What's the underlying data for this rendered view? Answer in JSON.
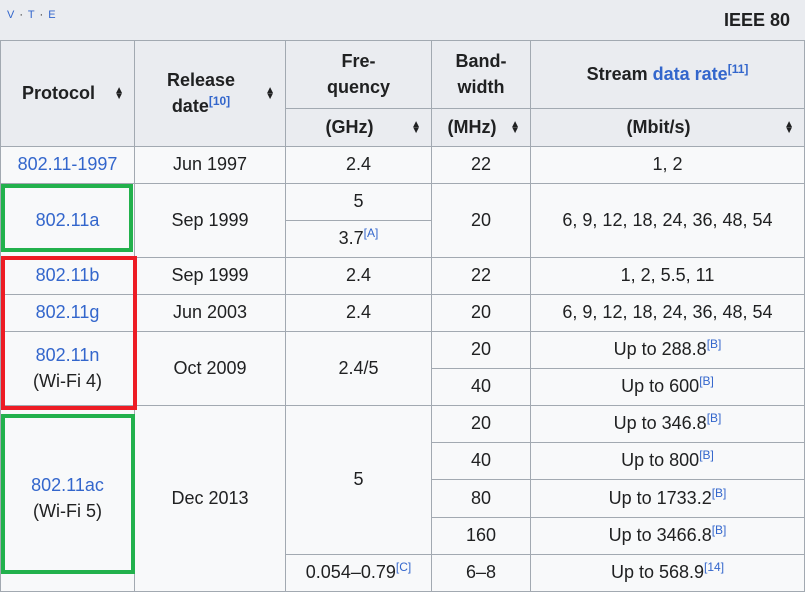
{
  "navbox": {
    "v": "V",
    "t": "T",
    "e": "E",
    "title": "IEEE 80"
  },
  "headers": {
    "protocol": "Protocol",
    "release_line1": "Release",
    "release_line2": "date",
    "release_ref": "[10]",
    "freq_line1": "Fre-",
    "freq_line2": "quency",
    "bw_line1": "Band-",
    "bw_line2": "width",
    "rate_prefix": "Stream",
    "rate_link": "data rate",
    "rate_ref": "[11]",
    "freq_unit": "(GHz)",
    "bw_unit": "(MHz)",
    "rate_unit": "(Mbit/s)"
  },
  "rows": {
    "r1997": {
      "protocol": "802.11-1997",
      "date": "Jun 1997",
      "freq": "2.4",
      "bw": "22",
      "rate": "1, 2"
    },
    "r11a": {
      "protocol": "802.11a",
      "date": "Sep 1999",
      "freq_a": "5",
      "freq_b": "3.7",
      "freq_b_ref": "[A]",
      "bw": "20",
      "rate": "6, 9, 12, 18, 24, 36, 48, 54"
    },
    "r11b": {
      "protocol": "802.11b",
      "date": "Sep 1999",
      "freq": "2.4",
      "bw": "22",
      "rate": "1, 2, 5.5, 11"
    },
    "r11g": {
      "protocol": "802.11g",
      "date": "Jun 2003",
      "freq": "2.4",
      "bw": "20",
      "rate": "6, 9, 12, 18, 24, 36, 48, 54"
    },
    "r11n": {
      "protocol": "802.11n",
      "alias": "(Wi-Fi 4)",
      "date": "Oct 2009",
      "freq": "2.4/5",
      "sub": [
        {
          "bw": "20",
          "rate": "Up to 288.8",
          "ref": "[B]"
        },
        {
          "bw": "40",
          "rate": "Up to 600",
          "ref": "[B]"
        }
      ]
    },
    "r11ac": {
      "protocol": "802.11ac",
      "alias": "(Wi-Fi 5)",
      "date": "Dec 2013",
      "freq": "5",
      "sub": [
        {
          "bw": "20",
          "rate": "Up to 346.8",
          "ref": "[B]"
        },
        {
          "bw": "40",
          "rate": "Up to 800",
          "ref": "[B]"
        },
        {
          "bw": "80",
          "rate": "Up to 1733.2",
          "ref": "[B]"
        },
        {
          "bw": "160",
          "rate": "Up to 3466.8",
          "ref": "[B]"
        }
      ],
      "extra": {
        "freq": "0.054–0.79",
        "freq_ref": "[C]",
        "bw": "6–8",
        "rate": "Up to 568.9",
        "rate_ref": "[14]"
      }
    }
  },
  "highlight_colors": {
    "green": "#22b14c",
    "red": "#ed1c24"
  },
  "icons": {
    "sort": "sort-arrows-icon"
  }
}
